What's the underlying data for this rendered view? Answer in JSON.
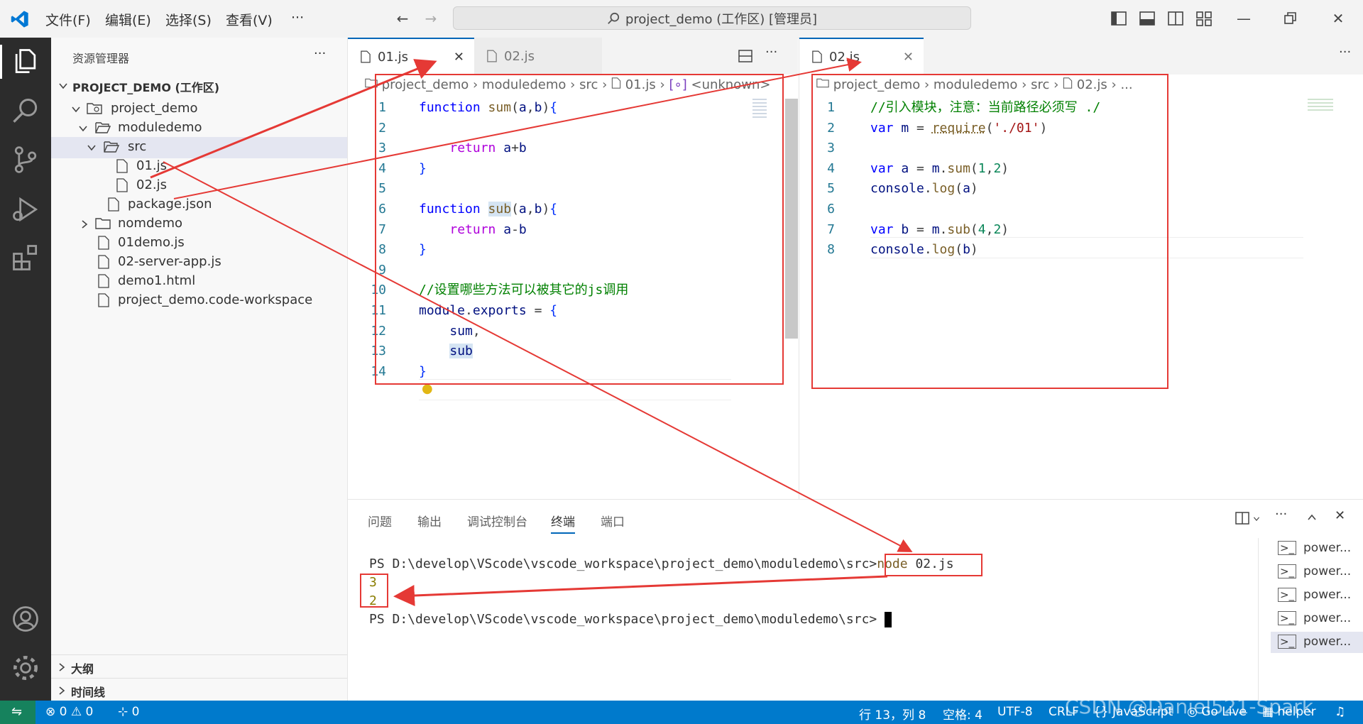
{
  "menu": {
    "file": "文件(F)",
    "edit": "编辑(E)",
    "select": "选择(S)",
    "view": "查看(V)",
    "more": "···"
  },
  "command_center": {
    "text": "project_demo (工作区) [管理员]"
  },
  "sidebar": {
    "title": "资源管理器",
    "more": "···",
    "workspace": "PROJECT_DEMO (工作区)",
    "items": [
      {
        "label": "project_demo"
      },
      {
        "label": "moduledemo"
      },
      {
        "label": "src"
      },
      {
        "label": "01.js"
      },
      {
        "label": "02.js"
      },
      {
        "label": "package.json"
      },
      {
        "label": "nomdemo"
      },
      {
        "label": "01demo.js"
      },
      {
        "label": "02-server-app.js"
      },
      {
        "label": "demo1.html"
      },
      {
        "label": "project_demo.code-workspace"
      }
    ],
    "outline": "大纲",
    "timeline": "时间线"
  },
  "editor1": {
    "tabs": [
      {
        "label": "01.js"
      },
      {
        "label": "02.js"
      }
    ],
    "more": "···",
    "breadcrumb": [
      "project_demo",
      "moduledemo",
      "src",
      "01.js",
      "<unknown>"
    ],
    "line_numbers": [
      "1",
      "2",
      "3",
      "4",
      "5",
      "6",
      "7",
      "8",
      "9",
      "10",
      "11",
      "12",
      "13",
      "14"
    ]
  },
  "editor2": {
    "tabs": [
      {
        "label": "02.js"
      }
    ],
    "more": "···",
    "breadcrumb": [
      "project_demo",
      "moduledemo",
      "src",
      "02.js",
      "..."
    ],
    "line_numbers": [
      "1",
      "2",
      "3",
      "4",
      "5",
      "6",
      "7",
      "8"
    ]
  },
  "panel": {
    "tabs": [
      "问题",
      "输出",
      "调试控制台",
      "终端",
      "端口"
    ],
    "active_tab": "终端",
    "prompt": "PS D:\\develop\\VScode\\vscode_workspace\\project_demo\\moduledemo\\src>",
    "command_word": "node",
    "command_arg": " 02.js",
    "output": [
      "3",
      "2"
    ],
    "terminals": [
      "power...",
      "power...",
      "power...",
      "power...",
      "power..."
    ]
  },
  "status": {
    "errors": "0",
    "warnings": "0",
    "ports": "0",
    "position": "行 13，列 8",
    "spaces": "空格: 4",
    "encoding": "UTF-8",
    "eol": "CRLF",
    "language": "JavaScript",
    "golive": "Go Live",
    "helper": "helper",
    "watermark": "CSDN @Daniel521-Spark"
  },
  "colors": {
    "accent": "#007acc",
    "activity_bar": "#2c2c2c",
    "annotation": "#e53935"
  }
}
